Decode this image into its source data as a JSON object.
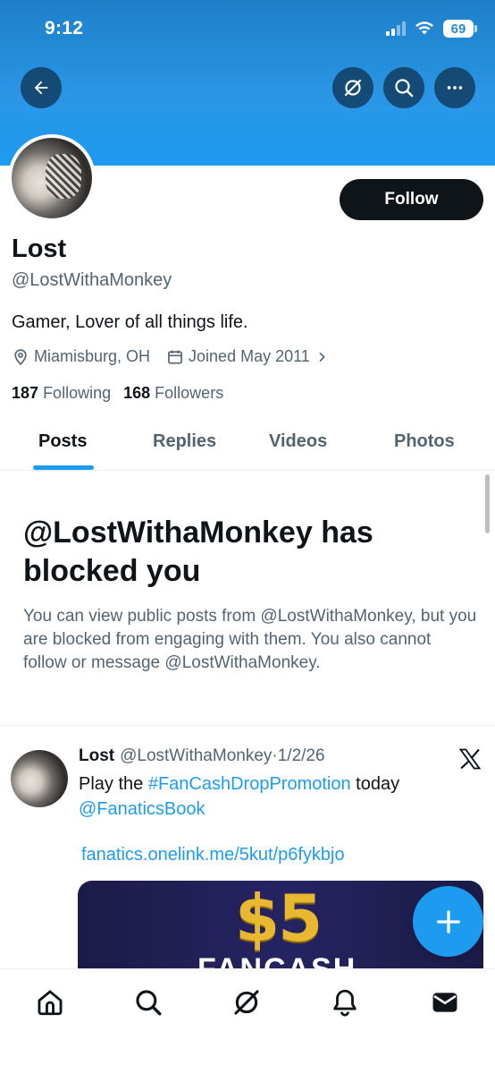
{
  "status_bar": {
    "time": "9:12",
    "battery": "69"
  },
  "header": {
    "back_icon": "arrow-left-icon",
    "grok_icon": "grok-icon",
    "search_icon": "search-icon",
    "more_icon": "more-icon"
  },
  "profile": {
    "display_name": "Lost",
    "handle": "@LostWithaMonkey",
    "bio": "Gamer, Lover of all things life.",
    "location": "Miamisburg, OH",
    "joined": "Joined May 2011",
    "following_count": "187",
    "following_label": "Following",
    "followers_count": "168",
    "followers_label": "Followers",
    "follow_label": "Follow"
  },
  "tabs": [
    {
      "label": "Posts",
      "active": true
    },
    {
      "label": "Replies",
      "active": false
    },
    {
      "label": "Videos",
      "active": false
    },
    {
      "label": "Photos",
      "active": false
    }
  ],
  "blocked": {
    "title": "@LostWithaMonkey has blocked you",
    "description": "You can view public posts from @LostWithaMonkey, but you are blocked from engaging with them. You also cannot follow or message @LostWithaMonkey."
  },
  "post": {
    "author_name": "Lost",
    "author_handle": "@LostWithaMonkey",
    "separator": "·",
    "date": "1/2/26",
    "text_prefix": "Play the ",
    "hashtag": "#FanCashDropPromotion",
    "text_suffix": " today",
    "mention": "@FanaticsBook",
    "link": "fanatics.onelink.me/5kut/p6fykbjo",
    "card_amount": "$5",
    "card_sub": "FANCASH"
  },
  "bottom_nav": [
    "home-icon",
    "search-icon",
    "grok-icon",
    "notifications-icon",
    "messages-icon"
  ],
  "colors": {
    "accent": "#1d9bf0",
    "text": "#0f1419",
    "muted": "#536471"
  }
}
